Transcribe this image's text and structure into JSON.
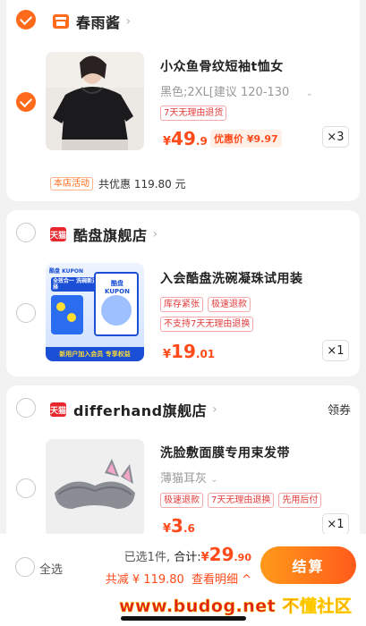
{
  "shops": [
    {
      "name": "春雨酱",
      "badge": "",
      "checked": true,
      "item": {
        "title": "小众鱼骨纹短袖t恤女",
        "sku": "黑色;2XL[建议 120-130",
        "tags": [
          "7天无理由退货"
        ],
        "price_currency": "¥",
        "price_int": "49",
        "price_dec": ".9",
        "promo_label": "优惠价 ¥",
        "promo_value": "9.97",
        "qty": "×3"
      },
      "activity_tag": "本店活动",
      "activity_text": "共优惠 119.80 元"
    },
    {
      "name": "酷盘旗舰店",
      "badge": "天猫",
      "checked": false,
      "item": {
        "title": "入会酷盘洗碗凝珠试用装",
        "tags": [
          "库存紧张",
          "极速退款",
          "不支持7天无理由退换"
        ],
        "price_currency": "¥",
        "price_int": "19",
        "price_dec": ".01",
        "qty": "×1",
        "image_text": {
          "brand": "酷盘 KUPON",
          "headline": "全效合一 洗碗新选择",
          "box_brand": "酷盘 KUPON",
          "footer": "新用户加入会员 专享权益"
        }
      }
    },
    {
      "name": "differhand旗舰店",
      "badge": "天猫",
      "checked": false,
      "coupon_label": "领券",
      "item": {
        "title": "洗脸敷面膜专用束发带",
        "sku": "薄猫耳灰",
        "tags": [
          "极速退款",
          "7天无理由退换",
          "先用后付"
        ],
        "price_currency": "¥",
        "price_int": "3",
        "price_dec": ".6",
        "qty": "×1"
      }
    }
  ],
  "bottom_bar": {
    "select_all": "全选",
    "selected_count": "已选1件,",
    "total_label": "合计:",
    "total_currency": "¥",
    "total_int": "29",
    "total_dec": ".90",
    "discount_text": "共减 ¥ 119.80",
    "detail_link": "查看明细",
    "checkout": "结算"
  },
  "watermark": "www.budog.net 不懂社区",
  "colors": {
    "accent": "#ff6a1a",
    "price": "#ff4a1a",
    "tmall": "#e8262d"
  }
}
